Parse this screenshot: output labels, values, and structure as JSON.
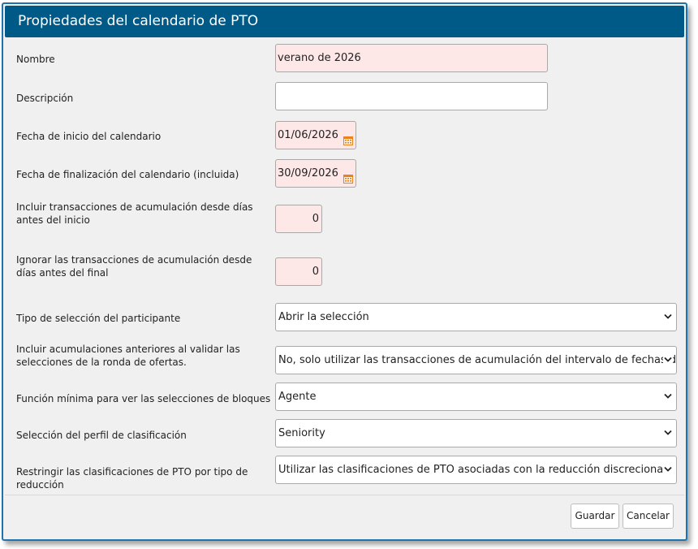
{
  "dialog": {
    "title": "Propiedades del calendario de PTO"
  },
  "fields": {
    "name": {
      "label": "Nombre",
      "value": "verano de 2026"
    },
    "description": {
      "label": "Descripción",
      "value": ""
    },
    "start_date": {
      "label": "Fecha de inicio del calendario",
      "value": "01/06/2026",
      "icon": "calendar-icon"
    },
    "end_date": {
      "label": "Fecha de finalización del calendario (incluida)",
      "value": "30/09/2026",
      "icon": "calendar-icon"
    },
    "accrual_before": {
      "label": "Incluir transacciones de acumulación desde días antes del inicio",
      "value": "0"
    },
    "accrual_ignore": {
      "label": "Ignorar las transacciones de acumulación desde días antes del final",
      "value": "0"
    },
    "participant_selection": {
      "label": "Tipo de selección del participante",
      "value": "Abrir la selección"
    },
    "prior_accruals": {
      "label": "Incluir acumulaciones anteriores al validar las selecciones de la ronda de ofertas.",
      "value": "No, solo utilizar las transacciones de acumulación del intervalo de fechas del calendario."
    },
    "min_role": {
      "label": "Función mínima para ver las selecciones de bloques",
      "value": "Agente"
    },
    "ranking_profile": {
      "label": "Selección del perfil de clasificación",
      "value": "Seniority"
    },
    "restrict_classifications": {
      "label": "Restringir las clasificaciones de PTO por tipo de reducción",
      "value": "Utilizar las clasificaciones de PTO asociadas con la reducción discrecional."
    }
  },
  "buttons": {
    "save": "Guardar",
    "cancel": "Cancelar"
  },
  "colors": {
    "title_bar": "#005a87",
    "required_field": "#fde7e7",
    "highlight_field": "#fbf9d3",
    "calendar_icon": "#e8821e"
  }
}
